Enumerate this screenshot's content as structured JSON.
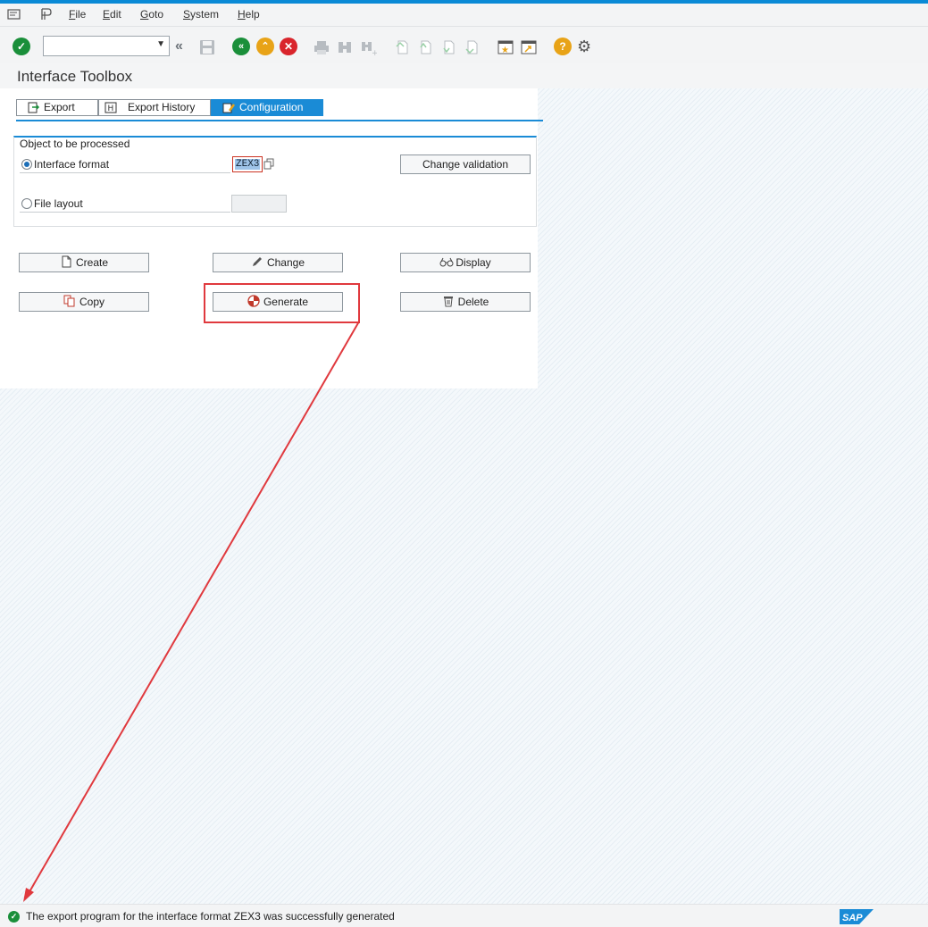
{
  "menubar": {
    "items": [
      {
        "underline": "F",
        "rest": "ile"
      },
      {
        "underline": "E",
        "rest": "dit"
      },
      {
        "underline": "G",
        "rest": "oto"
      },
      {
        "underline": "S",
        "rest": "ystem"
      },
      {
        "underline": "H",
        "rest": "elp"
      }
    ]
  },
  "toolbar": {
    "command_value": ""
  },
  "page": {
    "title": "Interface Toolbox"
  },
  "tabs": [
    {
      "label": "Export",
      "active": false
    },
    {
      "label": "Export History",
      "active": false
    },
    {
      "label": "Configuration",
      "active": true
    }
  ],
  "object_group": {
    "title": "Object to be processed",
    "options": [
      {
        "label": "Interface format",
        "selected": true,
        "value": "ZEX3"
      },
      {
        "label": "File layout",
        "selected": false,
        "value": ""
      }
    ],
    "change_validation_label": "Change validation"
  },
  "actions": {
    "create": "Create",
    "change": "Change",
    "display": "Display",
    "copy": "Copy",
    "generate": "Generate",
    "delete": "Delete"
  },
  "status": {
    "message": "The export program for the interface format ZEX3 was successfully generated",
    "type": "success"
  },
  "brand": {
    "logo_text": "SAP",
    "accent_color": "#1a8bd6",
    "highlight_color": "#e0393e",
    "success_color": "#1a8f3a"
  }
}
